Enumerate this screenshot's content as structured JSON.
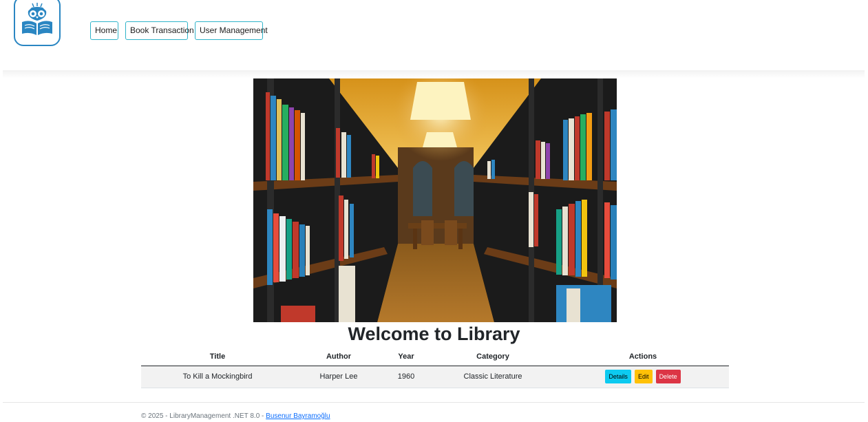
{
  "nav": {
    "items": [
      {
        "label": "Home"
      },
      {
        "label": "Book Transaction"
      },
      {
        "label": "User Management"
      }
    ]
  },
  "main": {
    "heading": "Welcome to Library"
  },
  "table": {
    "headers": [
      "Title",
      "Author",
      "Year",
      "Category",
      "Actions"
    ],
    "rows": [
      {
        "title": "To Kill a Mockingbird",
        "author": "Harper Lee",
        "year": "1960",
        "category": "Classic Literature"
      }
    ],
    "actions": {
      "details": "Details",
      "edit": "Edit",
      "delete": "Delete"
    }
  },
  "footer": {
    "text": "© 2025 - LibraryManagement .NET 8.0 - ",
    "link": "Busenur Bayramoğlu"
  },
  "colors": {
    "nav_border": "#2fb3c9",
    "logo_blue": "#2a86c2",
    "details_button": "#0dcaf0",
    "edit_button": "#ffc107",
    "delete_button": "#dc3545",
    "link": "#0d6efd"
  },
  "icons": {
    "logo": "owl-reading-book-icon"
  }
}
